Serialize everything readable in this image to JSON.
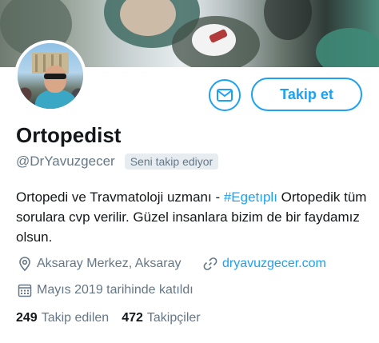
{
  "profile": {
    "name": "Ortopedist",
    "handle": "@DrYavuzgecer",
    "follows_you_badge": "Seni takip ediyor",
    "bio_line1": "Ortopedi ve Travmatoloji uzmanı - ",
    "bio_hashtag": "#Egetıplı",
    "bio_rest": "Ortopedik tüm sorulara cvp verilir. Güzel insanlara bizim de bir faydamız olsun.",
    "location": "Aksaray Merkez, Aksaray",
    "website": "dryavuzgecer.com",
    "joined": "Mayıs 2019 tarihinde katıldı"
  },
  "actions": {
    "follow_label": "Takip et",
    "message_icon": "envelope-icon"
  },
  "stats": {
    "following_count": "249",
    "following_label": "Takip edilen",
    "followers_count": "472",
    "followers_label": "Takipçiler"
  },
  "icons": {
    "location": "location-pin-icon",
    "link": "link-icon",
    "calendar": "calendar-icon"
  },
  "colors": {
    "accent": "#1da1f2",
    "muted": "#657786",
    "text": "#14171a"
  }
}
